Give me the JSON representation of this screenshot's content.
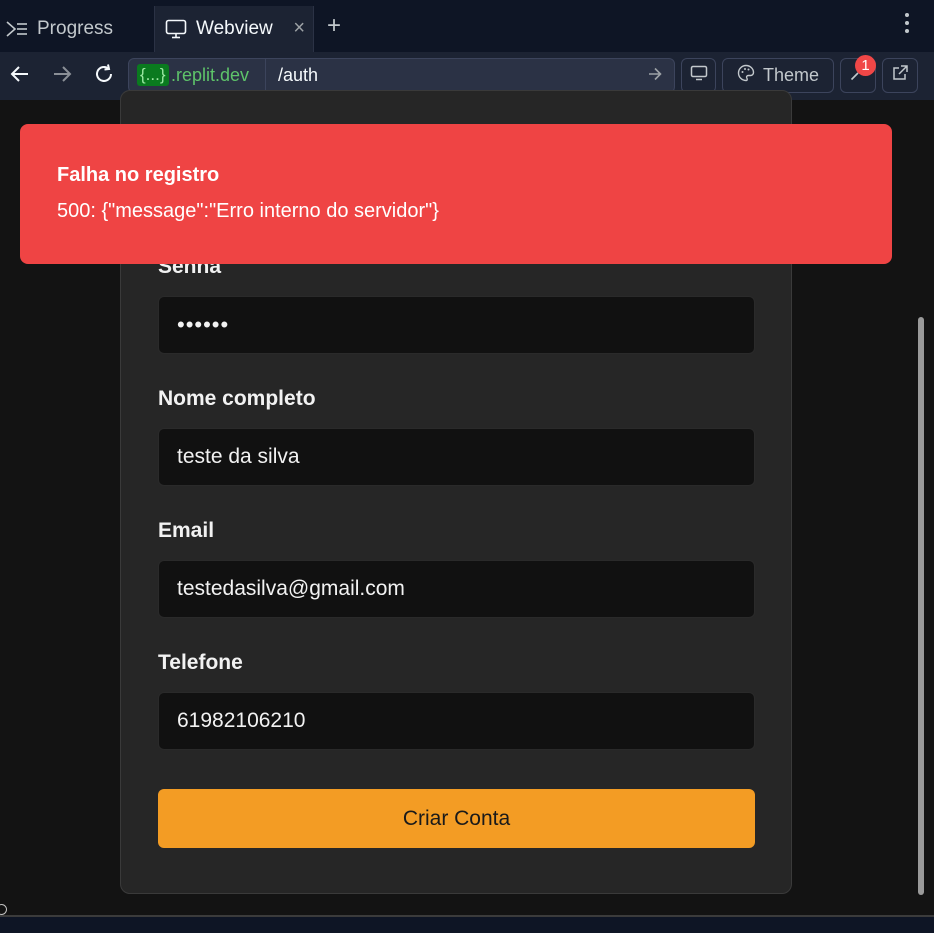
{
  "tabs": {
    "progress_label": "Progress",
    "webview_label": "Webview",
    "close_glyph": "×",
    "new_tab_glyph": "+"
  },
  "address_bar": {
    "prefix": "{...}",
    "domain": ".replit.dev",
    "path": "/auth"
  },
  "toolbar": {
    "theme_label": "Theme",
    "notification_count": "1"
  },
  "toast": {
    "title": "Falha no registro",
    "message": "500: {\"message\":\"Erro interno do servidor\"}",
    "background": "#ef4444"
  },
  "form": {
    "password_label": "Senha",
    "password_value": "••••••",
    "fullname_label": "Nome completo",
    "fullname_value": "teste da silva",
    "email_label": "Email",
    "email_value": "testedasilva@gmail.com",
    "phone_label": "Telefone",
    "phone_value": "61982106210",
    "submit_label": "Criar Conta",
    "submit_color": "#f39c24"
  }
}
